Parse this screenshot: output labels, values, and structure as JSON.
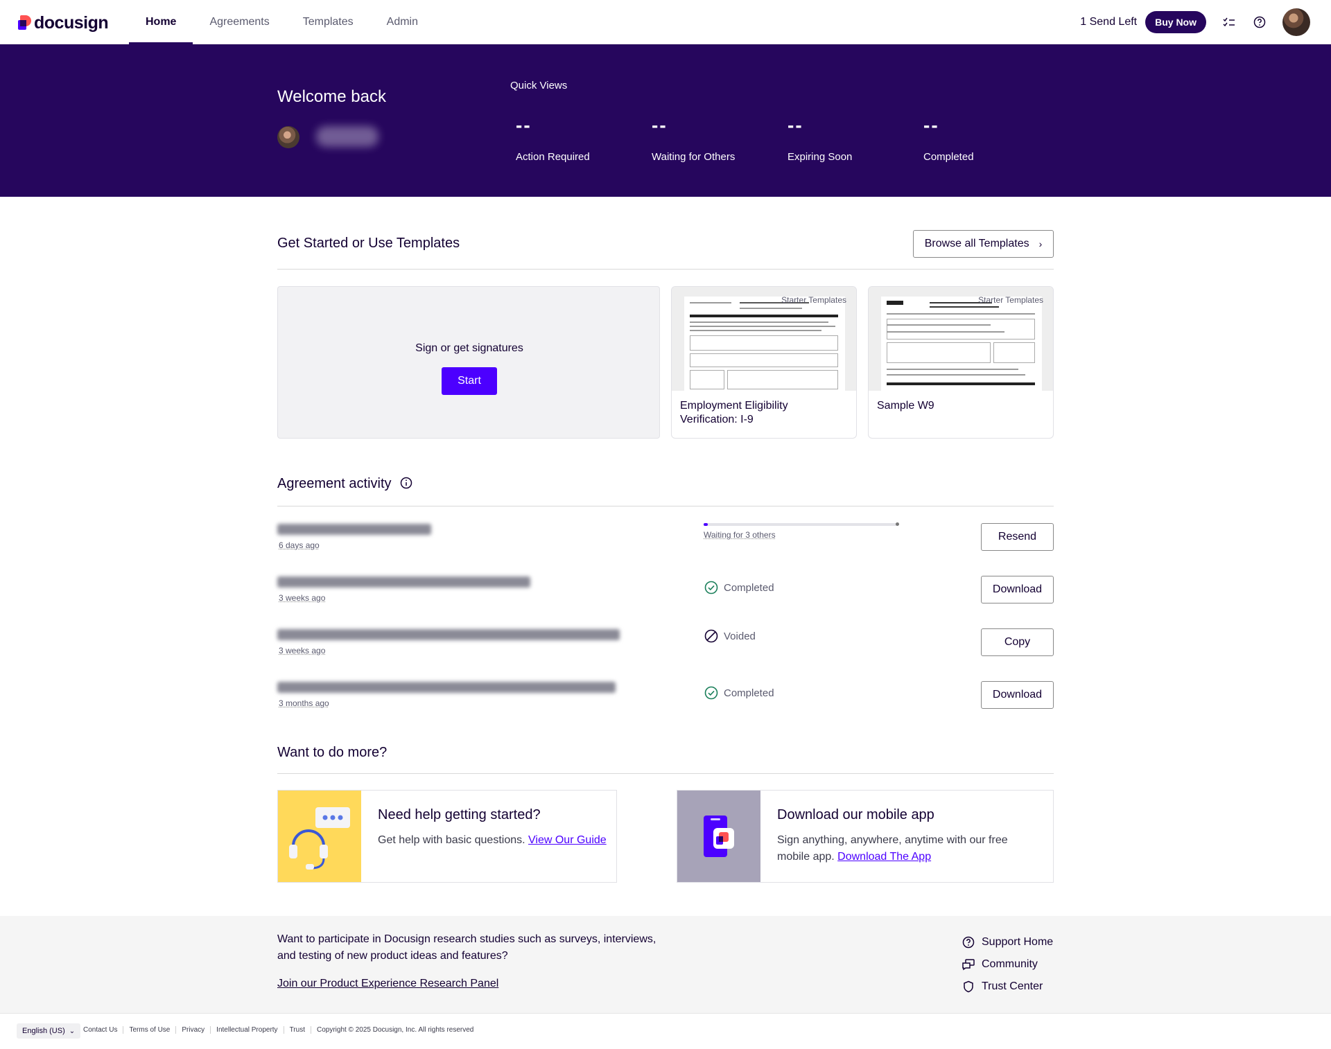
{
  "nav": {
    "logo": "docusign",
    "tabs": [
      "Home",
      "Agreements",
      "Templates",
      "Admin"
    ],
    "sends_left": "1 Send Left",
    "buy_now": "Buy Now"
  },
  "hero": {
    "welcome": "Welcome back",
    "quick_views_title": "Quick Views",
    "quick_views": [
      {
        "count": "--",
        "label": "Action Required"
      },
      {
        "count": "--",
        "label": "Waiting for Others"
      },
      {
        "count": "--",
        "label": "Expiring Soon"
      },
      {
        "count": "--",
        "label": "Completed"
      }
    ]
  },
  "get_started": {
    "title": "Get Started or Use Templates",
    "browse_label": "Browse all Templates",
    "start_prompt": "Sign or get signatures",
    "start_label": "Start",
    "templates": [
      {
        "tag": "Starter Templates",
        "name": "Employment Eligibility Verification: I-9"
      },
      {
        "tag": "Starter Templates",
        "name": "Sample W9"
      }
    ]
  },
  "activity": {
    "title": "Agreement activity",
    "rows": [
      {
        "time": "6 days ago",
        "status": "Waiting for 3 others",
        "progress": 0.02,
        "action": "Resend"
      },
      {
        "time": "3 weeks ago",
        "status": "Completed",
        "action": "Download"
      },
      {
        "time": "3 weeks ago",
        "status": "Voided",
        "action": "Copy"
      },
      {
        "time": "3 months ago",
        "status": "Completed",
        "action": "Download"
      }
    ]
  },
  "more": {
    "title": "Want to do more?",
    "help": {
      "title": "Need help getting started?",
      "text": "Get help with basic questions.",
      "link": "View Our Guide"
    },
    "app": {
      "title": "Download our mobile app",
      "text": "Sign anything, anywhere, anytime with our free mobile app.",
      "link": "Download The App"
    }
  },
  "footer": {
    "research_text": "Want to participate in Docusign research studies such as surveys, interviews, and testing of new product ideas and features?",
    "research_link": "Join our Product Experience Research Panel",
    "links": [
      "Support Home",
      "Community",
      "Trust Center"
    ],
    "language": "English (US)",
    "legal": [
      "Contact Us",
      "Terms of Use",
      "Privacy",
      "Intellectual Property",
      "Trust",
      "Copyright © 2025 Docusign, Inc. All rights reserved"
    ]
  },
  "colors": {
    "brand_dark": "#26065d",
    "brand_accent": "#4c00ff",
    "success": "#1a7f5a"
  }
}
